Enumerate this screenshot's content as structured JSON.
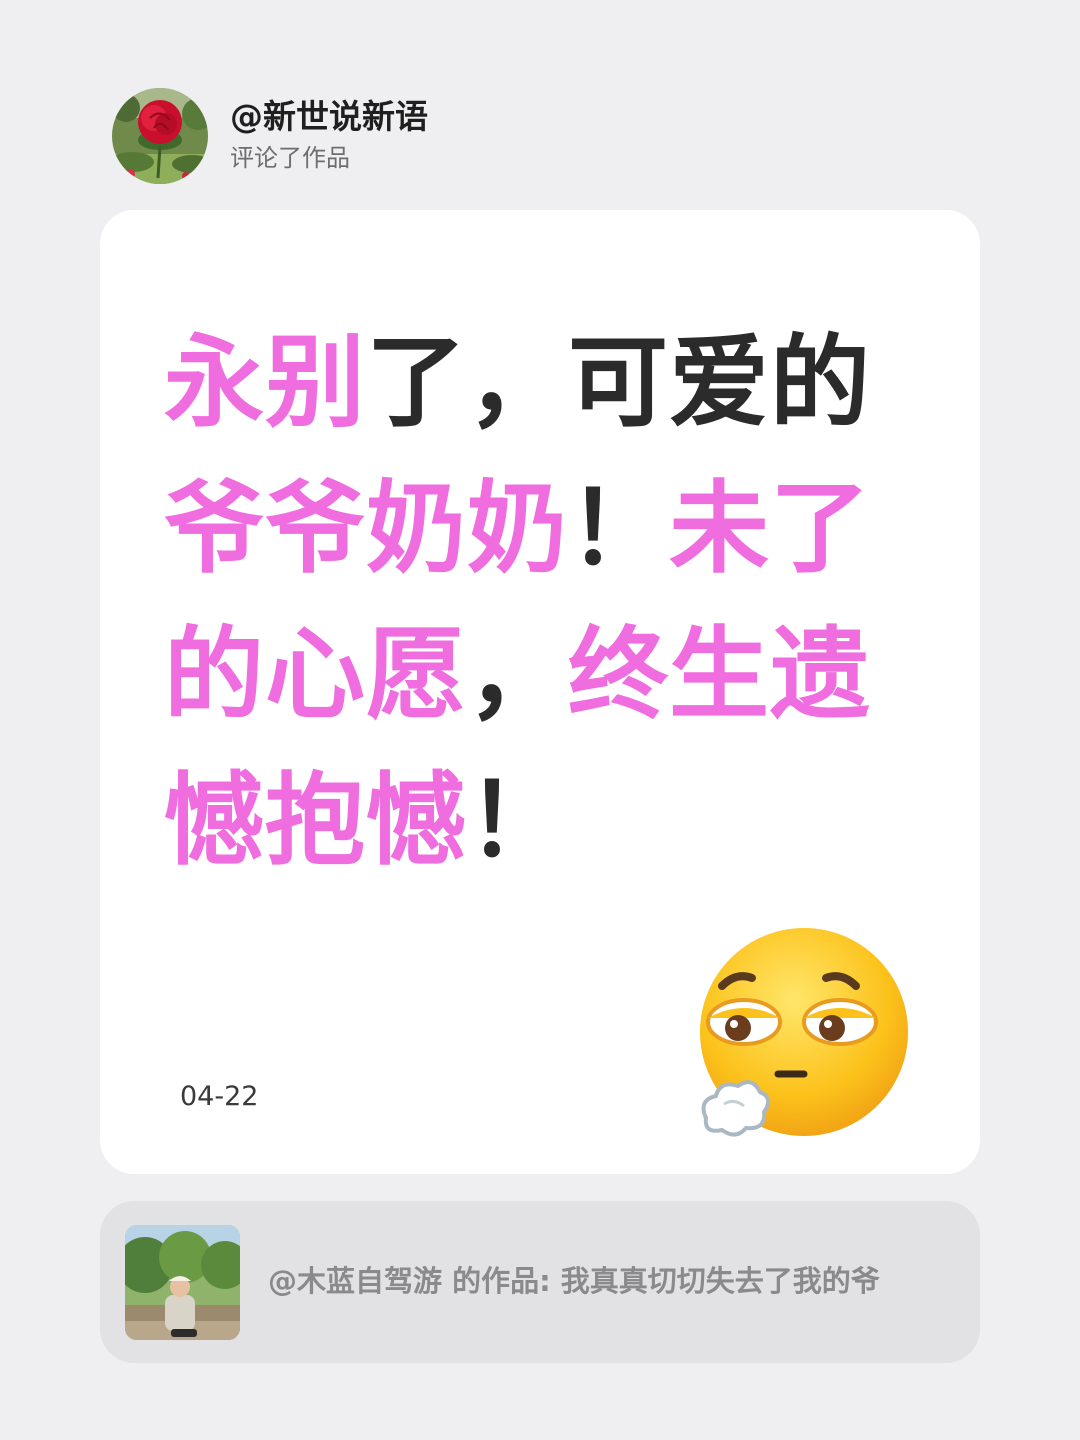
{
  "header": {
    "username": "@新世说新语",
    "action": "评论了作品",
    "avatar_icon": "red-rose-photo"
  },
  "comment": {
    "segments": [
      {
        "text": "永别",
        "color": "#f06de0"
      },
      {
        "text": "了，可爱的",
        "color": "#2b2b2b"
      },
      {
        "text": "爷爷奶奶",
        "color": "#f06de0"
      },
      {
        "text": "！",
        "color": "#2b2b2b"
      },
      {
        "text": "未了的心愿",
        "color": "#f06de0"
      },
      {
        "text": "，",
        "color": "#2b2b2b"
      },
      {
        "text": "终生遗憾抱憾",
        "color": "#f06de0"
      },
      {
        "text": "！",
        "color": "#2b2b2b"
      }
    ],
    "date": "04-22",
    "emoji_icon": "face-exhaling-emoji"
  },
  "referenced_work": {
    "text": "@木蓝自驾游 的作品: 我真真切切失去了我的爷",
    "thumbnail_icon": "person-outdoor-photo"
  },
  "colors": {
    "accent_pink": "#f06de0",
    "text_dark": "#2b2b2b",
    "background": "#efeff1",
    "card": "#ffffff",
    "reference_bg": "#e2e2e4"
  }
}
